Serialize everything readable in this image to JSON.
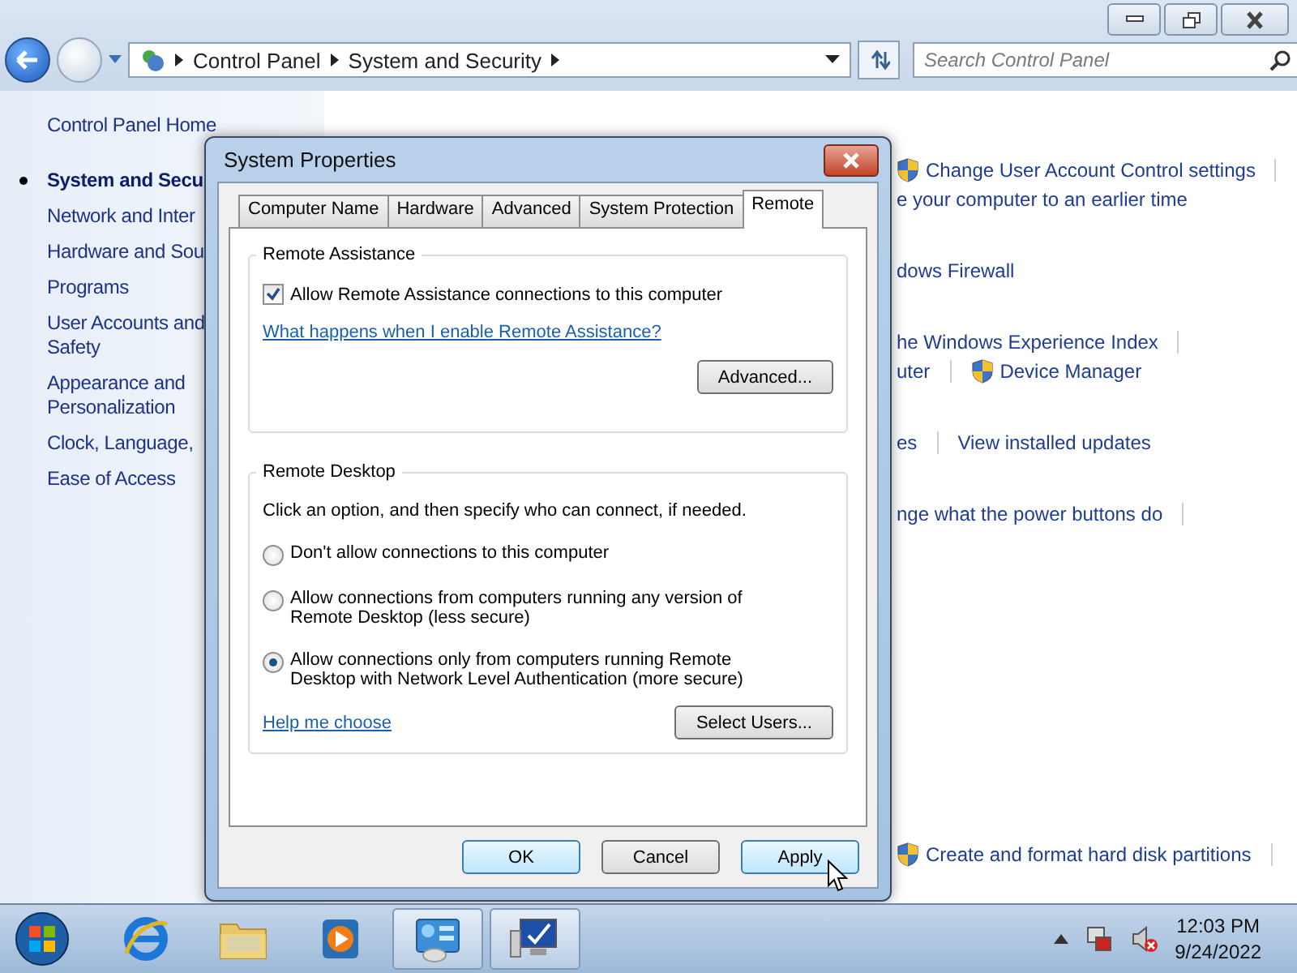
{
  "address_bar": {
    "breadcrumbs": [
      "Control Panel",
      "System and Security"
    ]
  },
  "search": {
    "placeholder": "Search Control Panel"
  },
  "sidebar": {
    "home": "Control Panel Home",
    "items": [
      {
        "lines": [
          "System and Secu"
        ],
        "selected": true
      },
      {
        "lines": [
          "Network and Inter"
        ],
        "selected": false
      },
      {
        "lines": [
          "Hardware and Sou"
        ],
        "selected": false
      },
      {
        "lines": [
          "Programs"
        ],
        "selected": false
      },
      {
        "lines": [
          "User Accounts and",
          "Safety"
        ],
        "selected": false
      },
      {
        "lines": [
          "Appearance and",
          "Personalization"
        ],
        "selected": false
      },
      {
        "lines": [
          "Clock, Language,"
        ],
        "selected": false
      },
      {
        "lines": [
          "Ease of Access"
        ],
        "selected": false
      }
    ]
  },
  "content": {
    "groups": [
      {
        "lines": [
          {
            "links": [
              {
                "text": "Change User Account Control settings",
                "shield": true
              }
            ],
            "trailing_divider": true
          },
          {
            "links": [
              {
                "text": "e your computer to an earlier time",
                "shield": false
              }
            ],
            "trailing_divider": false
          }
        ]
      },
      {
        "lines": [
          {
            "links": [
              {
                "text": "dows Firewall",
                "shield": false
              }
            ],
            "trailing_divider": false
          }
        ]
      },
      {
        "lines": [
          {
            "links": [
              {
                "text": "he Windows Experience Index",
                "shield": false
              }
            ],
            "trailing_divider": true
          },
          {
            "links": [
              {
                "text": "uter",
                "shield": false
              },
              {
                "text": "Device Manager",
                "shield": true
              }
            ],
            "trailing_divider": false
          }
        ]
      },
      {
        "lines": [
          {
            "links": [
              {
                "text": "es",
                "shield": false
              },
              {
                "text": "View installed updates",
                "shield": false
              }
            ],
            "trailing_divider": false
          }
        ]
      },
      {
        "lines": [
          {
            "links": [
              {
                "text": "nge what the power buttons do",
                "shield": false
              }
            ],
            "trailing_divider": true
          }
        ]
      },
      {
        "lines": [
          {
            "links": [
              {
                "text": "Create and format hard disk partitions",
                "shield": true
              }
            ],
            "trailing_divider": true
          }
        ]
      }
    ]
  },
  "dialog": {
    "title": "System Properties",
    "tabs": [
      {
        "label": "Computer Name",
        "selected": false
      },
      {
        "label": "Hardware",
        "selected": false
      },
      {
        "label": "Advanced",
        "selected": false
      },
      {
        "label": "System Protection",
        "selected": false
      },
      {
        "label": "Remote",
        "selected": true
      }
    ],
    "remote_assistance": {
      "title": "Remote Assistance",
      "checkbox": {
        "label": "Allow Remote Assistance connections to this computer",
        "checked": true
      },
      "link": "What happens when I enable Remote Assistance?",
      "button": "Advanced..."
    },
    "remote_desktop": {
      "title": "Remote Desktop",
      "instruction": "Click an option, and then specify who can connect, if needed.",
      "options": [
        {
          "label": "Don't allow connections to this computer",
          "selected": false
        },
        {
          "label": "Allow connections from computers running any version of Remote Desktop (less secure)",
          "selected": false
        },
        {
          "label": "Allow connections only from computers running Remote Desktop with Network Level Authentication (more secure)",
          "selected": true
        }
      ],
      "link": "Help me choose",
      "button": "Select Users..."
    },
    "buttons": [
      {
        "label": "OK",
        "highlighted": true
      },
      {
        "label": "Cancel",
        "highlighted": false
      },
      {
        "label": "Apply",
        "highlighted": true
      }
    ]
  },
  "taskbar": {
    "items": [
      {
        "kind": "browser",
        "running": false
      },
      {
        "kind": "folder",
        "running": false
      },
      {
        "kind": "media",
        "running": false
      },
      {
        "kind": "control-panel",
        "running": true
      },
      {
        "kind": "monitor",
        "running": true
      }
    ],
    "time": "12:03 PM",
    "date": "9/24/2022"
  }
}
